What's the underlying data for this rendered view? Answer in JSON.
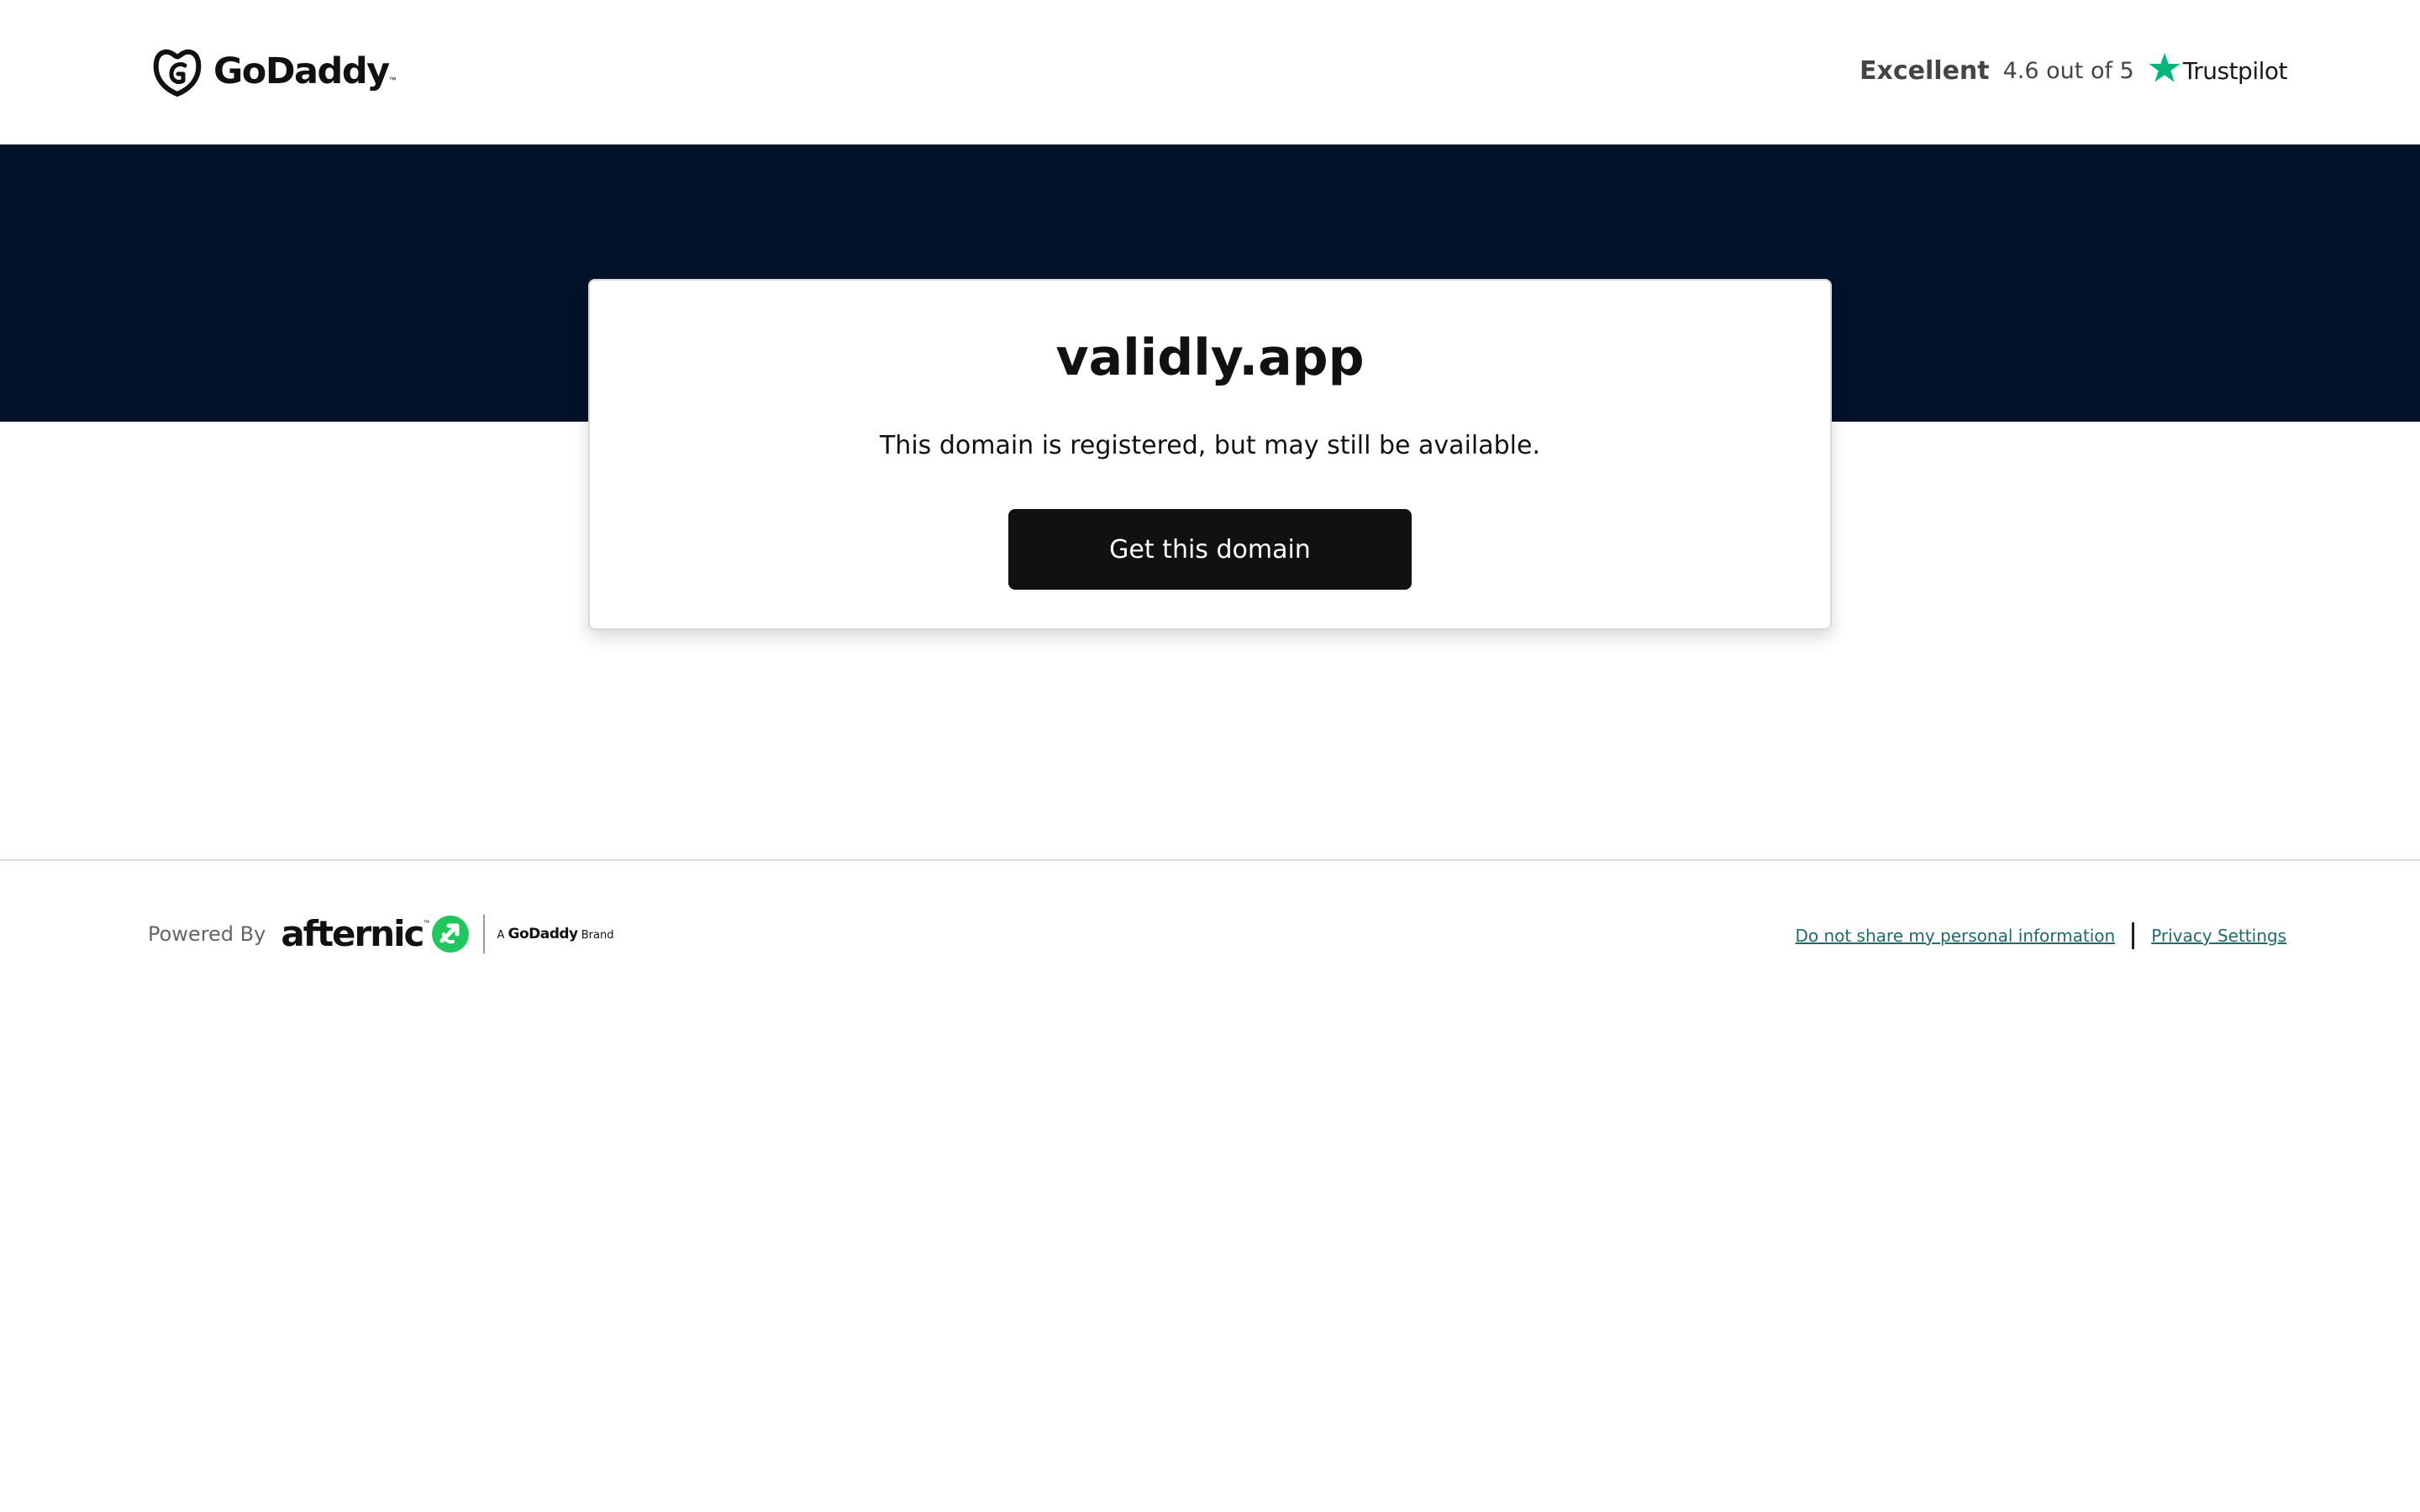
{
  "header": {
    "brand": "GoDaddy",
    "brand_tm": "™",
    "logo_icon": "godaddy-logo-icon",
    "rating_label": "Excellent",
    "rating_score": "4.6 out of 5",
    "rating_icon": "trustpilot-star-icon",
    "rating_brand": "Trustpilot"
  },
  "card": {
    "domain": "validly.app",
    "description": "This domain is registered, but may still be available.",
    "cta_label": "Get this domain"
  },
  "footer": {
    "powered_by": "Powered By",
    "partner": "afternic",
    "partner_tm": "™",
    "partner_icon": "afternic-logo-icon",
    "brand_tag_prefix": "A",
    "brand_tag_name": "GoDaddy",
    "brand_tag_suffix": "Brand",
    "link_do_not_share": "Do not share my personal information",
    "link_privacy": "Privacy Settings"
  },
  "colors": {
    "hero_band": "#00132b",
    "cta_bg": "#111111",
    "trustpilot_green": "#00b67a",
    "afternic_green": "#22c55e",
    "footer_link": "#1f6b6b"
  }
}
